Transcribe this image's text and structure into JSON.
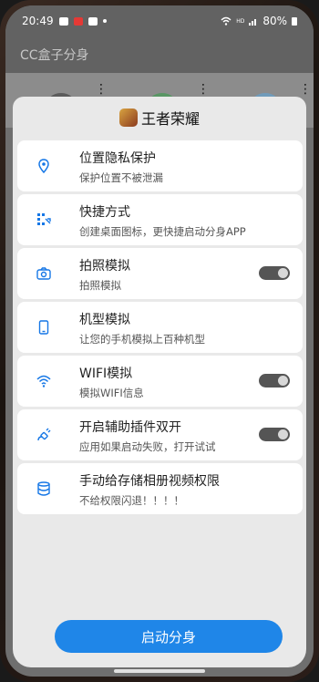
{
  "status_bar": {
    "time": "20:49",
    "hd": "HD",
    "battery": "80%"
  },
  "app_bar": {
    "title": "CC盒子分身"
  },
  "background": {
    "overflow": "⋮"
  },
  "sheet": {
    "title": "王者荣耀",
    "items": [
      {
        "title": "位置隐私保护",
        "subtitle": "保护位置不被泄漏",
        "icon": "location-pin-icon",
        "has_toggle": false
      },
      {
        "title": "快捷方式",
        "subtitle": "创建桌面图标，更快捷启动分身APP",
        "icon": "grid-shortcut-icon",
        "has_toggle": false
      },
      {
        "title": "拍照模拟",
        "subtitle": "拍照模拟",
        "icon": "camera-icon",
        "has_toggle": true,
        "toggle_on": false
      },
      {
        "title": "机型模拟",
        "subtitle": "让您的手机模拟上百种机型",
        "icon": "phone-device-icon",
        "has_toggle": false
      },
      {
        "title": "WIFI模拟",
        "subtitle": "模拟WIFI信息",
        "icon": "wifi-icon",
        "has_toggle": true,
        "toggle_on": false
      },
      {
        "title": "开启辅助插件双开",
        "subtitle": "应用如果启动失败，打开试试",
        "icon": "plug-icon",
        "has_toggle": true,
        "toggle_on": false
      },
      {
        "title": "手动给存储相册视频权限",
        "subtitle": "不给权限闪退！！！！",
        "icon": "database-icon",
        "has_toggle": false
      }
    ],
    "launch_button": "启动分身"
  },
  "colors": {
    "accent": "#1f86e8",
    "icon": "#1677e6",
    "toggle_off": "#555555"
  }
}
